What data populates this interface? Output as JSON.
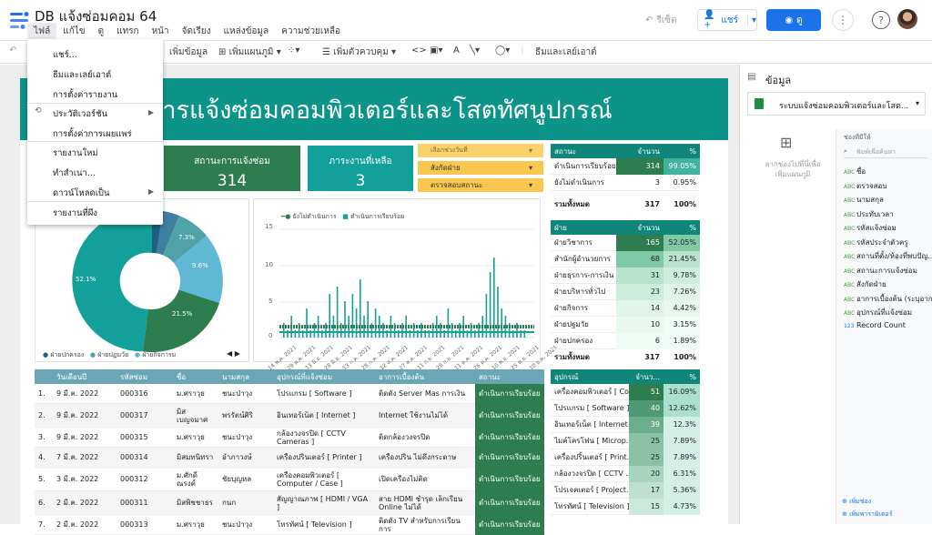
{
  "header": {
    "title": "DB แจ้งซ่อมคอม 64",
    "menu": [
      "ไฟล์",
      "แก้ไข",
      "ดู",
      "แทรก",
      "หน้า",
      "จัดเรียง",
      "แหล่งข้อมูล",
      "ความช่วยเหลือ"
    ],
    "reset": "รีเซ็ต",
    "share": "แชร์",
    "view": "ดู"
  },
  "toolbar": {
    "add_data": "เพิ่มข้อมูล",
    "add_chart": "เพิ่มแผนภูมิ",
    "add_control": "เพิ่มตัวควบคุม",
    "theme": "ธีมและเลย์เอาต์"
  },
  "file_menu": {
    "items": [
      "แชร์...",
      "ธีมและเลย์เอาต์",
      "การตั้งค่ารายงาน",
      "ประวัติเวอร์ชัน",
      "การตั้งค่าการเผยแพร่",
      "รายงานใหม่",
      "ทำสำเนา...",
      "ดาวน์โหลดเป็น",
      "รายงานที่ผึง"
    ]
  },
  "report": {
    "title": "การแจ้งซ่อมคอมพิวเตอร์และโสตทัศนูปกรณ์",
    "score_status": {
      "label": "สถานะการแจ้งซ่อม",
      "value": "314"
    },
    "score_remain": {
      "label": "ภาระงานที่เหลือ",
      "value": "3"
    },
    "filters": [
      "เลือกช่วงวันที่",
      "สังกัดฝ่าย",
      "ตรวจสอบสถานะ"
    ],
    "donut": {
      "labels": [
        "52.1%",
        "21.5%",
        "9.6%",
        "7.3%"
      ],
      "legend": [
        "ฝ่ายปกครอง",
        "ฝ่ายปฏมวัย",
        "ฝ่ายกิจการม"
      ]
    },
    "line_chart": {
      "legend": [
        "ยังไม่ดำเนินการ",
        "ดำเนินการเรียบร้อย"
      ],
      "yticks": [
        "15",
        "10",
        "5",
        "0"
      ],
      "xticks": [
        "14 พ.ค. 2021",
        "29 พ.ค. 2021",
        "13 มิ.ย. 2021",
        "28 มิ.ย. 2021",
        "13 ก.ค. 2021",
        "28 ก.ค. 2021",
        "12 ส.ค. 2021",
        "27 ส.ค. 2021",
        "11 ก.ย. 2021",
        "26 ก.ย. 2021",
        "11 ต.ค. 2021",
        "26 ต.ค. 2021",
        "10 พ.ย. 2021",
        "25 พ.ย. 2021",
        "10 ธ.ค. 2021"
      ]
    },
    "status_table": {
      "headers": [
        "สถานะ",
        "จำนวน",
        "%"
      ],
      "rows": [
        [
          "ดำเนินการเรียบร้อย",
          "314",
          "99.05%"
        ],
        [
          "ยังไม่ดำเนินการ",
          "3",
          "0.95%"
        ]
      ],
      "total": [
        "รวมทั้งหมด",
        "317",
        "100%"
      ]
    },
    "dept_table": {
      "headers": [
        "ฝ่าย",
        "จำนวน",
        "%"
      ],
      "rows": [
        [
          "ฝ่ายวิชาการ",
          "165",
          "52.05%"
        ],
        [
          "สำนักผู้อำนวยการ",
          "68",
          "21.45%"
        ],
        [
          "ฝ่ายธุรการ-การเงิน",
          "31",
          "9.78%"
        ],
        [
          "ฝ่ายบริหารทั่วไป",
          "23",
          "7.26%"
        ],
        [
          "ฝ่ายกิจการ",
          "14",
          "4.42%"
        ],
        [
          "ฝ่ายปฐมวัย",
          "10",
          "3.15%"
        ],
        [
          "ฝ่ายปกครอง",
          "6",
          "1.89%"
        ]
      ],
      "total": [
        "รวมทั้งหมด",
        "317",
        "100%"
      ]
    },
    "equip_table": {
      "headers": [
        "อุปกรณ์",
        "จำนว...",
        "%"
      ],
      "rows": [
        [
          "เครื่องคอมพิวเตอร์ [ Co...",
          "51",
          "16.09%"
        ],
        [
          "โปรแกรม [ Software ]",
          "40",
          "12.62%"
        ],
        [
          "อินเทอร์เน็ต [ Internet ]",
          "39",
          "12.3%"
        ],
        [
          "ไมค์โครโฟน [ Microp...",
          "25",
          "7.89%"
        ],
        [
          "เครื่องปริ้นเตอร์ [ Print...",
          "25",
          "7.89%"
        ],
        [
          "กล้องวงจรปิด [ CCTV ...",
          "20",
          "6.31%"
        ],
        [
          "โปรเจคเตอร์ [ Project...",
          "17",
          "5.36%"
        ],
        [
          "โทรทัศน์ [ Television ]",
          "15",
          "4.73%"
        ]
      ]
    },
    "main_table": {
      "headers": [
        "วันเดือนปี",
        "รหัสซ่อม",
        "ชื่อ",
        "นามสกุล",
        "อุปกรณ์ที่แจ้งซ่อม",
        "อาการเบื้องต้น",
        "สถานะ"
      ],
      "rows": [
        [
          "1.",
          "9 มี.ค. 2022",
          "000316",
          "ม.ศราวุธ",
          "ชนะป่าวุง",
          "โปรแกรม [ Software ]",
          "ติดตั้ง Server Mas การเงิน",
          "ดำเนินการเรียบร้อย"
        ],
        [
          "2.",
          "9 มี.ค. 2022",
          "000317",
          "มิส เบญจมาศ",
          "พรรัตน์ศิริ",
          "อินเทอร์เน็ต [ Internet ]",
          "Internet ใช้งานไม่ได้",
          "ดำเนินการเรียบร้อย"
        ],
        [
          "3.",
          "9 มี.ค. 2022",
          "000315",
          "ม.ศราวุธ",
          "ชนะป่าวุง",
          "กล้องวงจรปิด [ CCTV Cameras ]",
          "ติดกล้องวงจรปิด",
          "ดำเนินการเรียบร้อย"
        ],
        [
          "4.",
          "7 มี.ค. 2022",
          "000314",
          "มิสมทนิทรา",
          "อำภาวงษ์",
          "เครื่องปริ้นเตอร์ [ Printer ]",
          "เครื่องปริ้น ไม่ดึงกระดาษ",
          "ดำเนินการเรียบร้อย"
        ],
        [
          "5.",
          "3 มี.ค. 2022",
          "000312",
          "ม.ศักดิ์ ณรงค์",
          "ชัยบุญหล",
          "เครื่องคอมพิวเตอร์ [ Computer / Case ]",
          "เปิดเครื่องไม่ติด",
          "ดำเนินการเรียบร้อย"
        ],
        [
          "6.",
          "2 มี.ค. 2022",
          "000311",
          "มิสพิชชาธร",
          "กนก",
          "สัญญาณภาพ [ HDMI / VGA ]",
          "สาย HDMI ชำรุด เล็กเรียน Online ไม่ได้",
          "ดำเนินการเรียบร้อย"
        ],
        [
          "7.",
          "2 มี.ค. 2022",
          "000313",
          "ม.ศราวุธ",
          "ชนะป่าวุง",
          "โทรทัศน์ [ Television ]",
          "ติดตั้ง TV สำหรับการเรียนการ",
          "ดำเนินการเรียบร้อย"
        ]
      ]
    }
  },
  "panel": {
    "title": "ข้อมูล",
    "source": "ระบบแจ้งซ่อมคอมพิวเตอร์และโสต...",
    "drop_hint_1": "ลากช่องไปที่นี่เพื่อ",
    "drop_hint_2": "เพิ่มแผนภูมิ",
    "fields_title": "ช่องที่มีให้",
    "search_placeholder": "พิมพ์เพื่อค้นหา",
    "fields": [
      "ชื่อ",
      "ตรวจสอบ",
      "นามสกุล",
      "ประทับเวลา",
      "รหัสแจ้งซ่อม",
      "รหัสประจำตัวครู",
      "สถานที่ตั้ง/ห้องที่พบปัญ...",
      "สถานะการแจ้งซ่อม",
      "สังกัดฝ่าย",
      "อาการเบื้องต้น (ระบุอาก...",
      "อุปกรณ์ที่แจ้งซ่อม",
      "Record Count"
    ],
    "add_field": "เพิ่มช่อง",
    "add_param": "เพิ่มพารามิเตอร์"
  }
}
